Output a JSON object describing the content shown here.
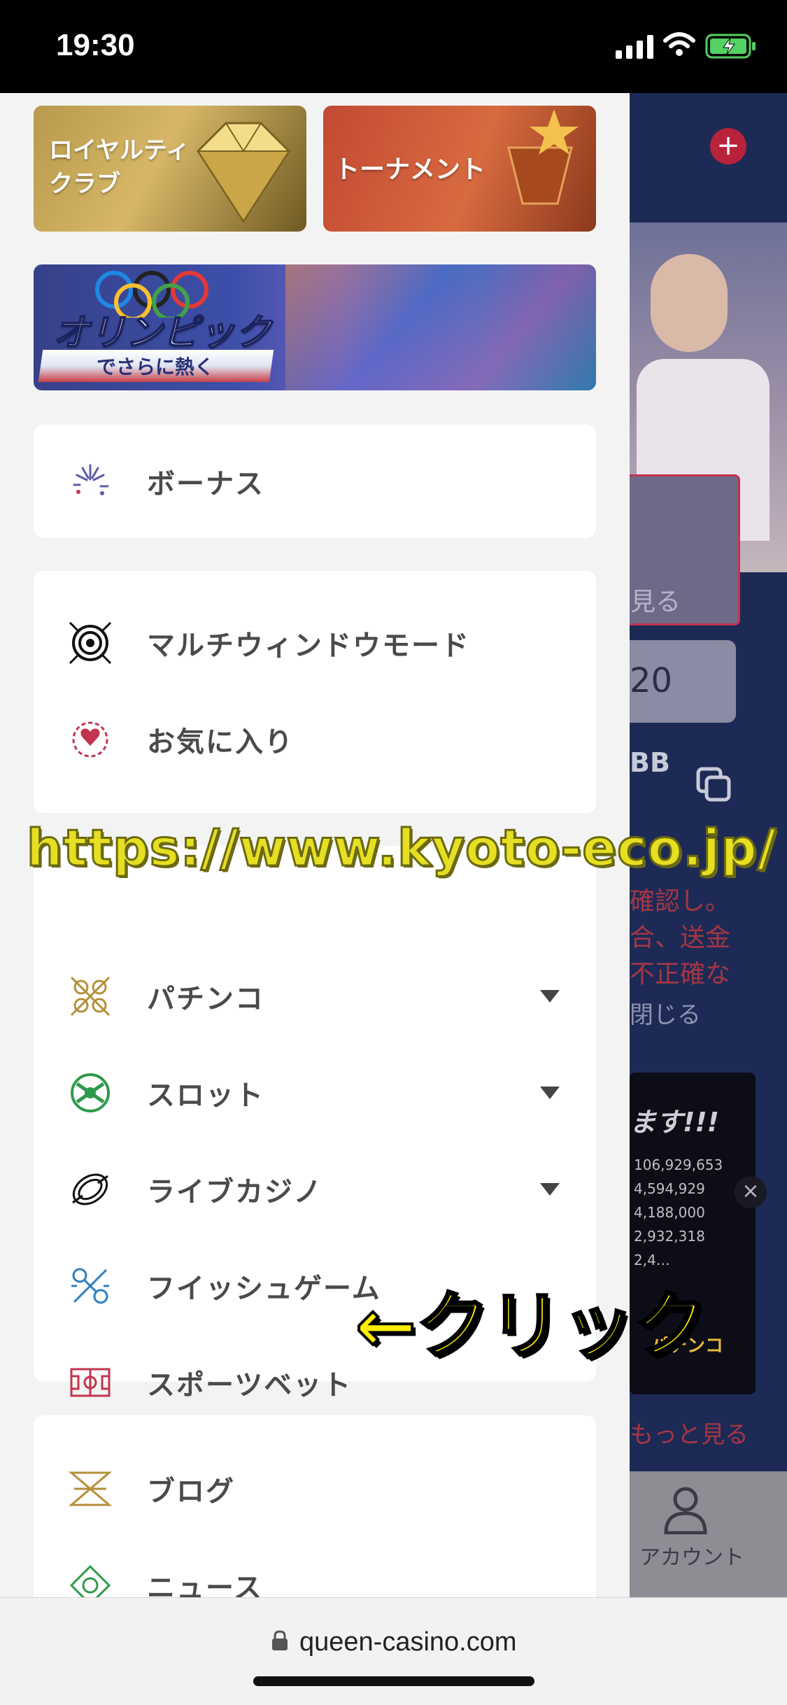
{
  "status_bar": {
    "time": "19:30"
  },
  "promos": {
    "loyalty_club": {
      "line1": "ロイヤルティ",
      "line2": "クラブ"
    },
    "tournament": {
      "label": "トーナメント"
    },
    "olympic": {
      "title": "オリンピック",
      "subtitle": "でさらに熱く"
    }
  },
  "menu": {
    "bonus": "ボーナス",
    "multi_window": "マルチウィンドウモード",
    "favorites": "お気に入り",
    "pachinko": "パチンコ",
    "slots": "スロット",
    "live_casino": "ライブカジノ",
    "fish_game": "フイッシュゲーム",
    "sports_bet": "スポーツベット",
    "blog": "ブログ",
    "news": "ニュース"
  },
  "background_app": {
    "see_more": "見る",
    "amount_fragment": "20",
    "bb_fragment": "BB",
    "notice_line1": "確認し。",
    "notice_line2": "合、送金",
    "notice_line3": "不正確な",
    "close_link": "閉じる",
    "banner_text": "ます!!!",
    "jackpots": [
      "106,929,653",
      "4,594,929",
      "4,188,000",
      "2,932,318",
      "2,4…"
    ],
    "pachinko_badge": "パチンコ",
    "see_more_bottom": "もっと見る",
    "account_tab": "アカウント"
  },
  "overlay": {
    "watermark_url": "https://www.kyoto-eco.jp/",
    "click_annotation": "←クリック"
  },
  "browser": {
    "url": "queen-casino.com"
  },
  "colors": {
    "drawer_bg": "#f3f3f3",
    "card_bg": "#ffffff",
    "menu_text": "#4a4a4a",
    "annotation_yellow": "#ffee00",
    "watermark_yellow": "#e6df22",
    "bg_app_navy": "#1d2a55"
  }
}
